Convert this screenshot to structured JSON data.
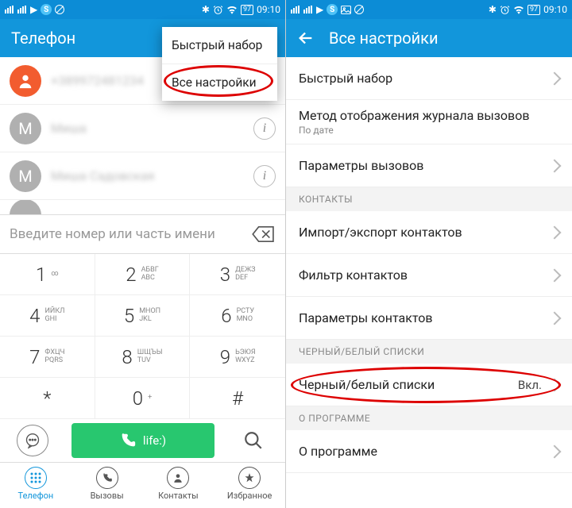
{
  "status": {
    "time": "09:10",
    "battery": "97"
  },
  "left": {
    "appTitle": "Телефон",
    "popup": {
      "item1": "Быстрый набор",
      "item2": "Все настройки"
    },
    "contacts": [
      {
        "letter": "",
        "name": "+389972481234"
      },
      {
        "letter": "M",
        "name": "Миша"
      },
      {
        "letter": "M",
        "name": "Миша Садовская"
      }
    ],
    "dialerPlaceholder": "Введите номер или часть имени",
    "keys": [
      {
        "n": "1",
        "l": "∞"
      },
      {
        "n": "2",
        "l": "АБВГ\nABC"
      },
      {
        "n": "3",
        "l": "ДЕЖЗ\nDEF"
      },
      {
        "n": "4",
        "l": "ИЙКЛ\nGHI"
      },
      {
        "n": "5",
        "l": "МНОП\nJKL"
      },
      {
        "n": "6",
        "l": "РСТУ\nMNO"
      },
      {
        "n": "7",
        "l": "ФХЦЧ\nPQRS"
      },
      {
        "n": "8",
        "l": "ШЩЪЫ\nTUV"
      },
      {
        "n": "9",
        "l": "ЬЭЮЯ\nWXYZ"
      },
      {
        "n": "*",
        "l": ""
      },
      {
        "n": "0",
        "l": "+"
      },
      {
        "n": "#",
        "l": ""
      }
    ],
    "callLabel": "life:)",
    "nav": {
      "phone": "Телефон",
      "calls": "Вызовы",
      "contacts": "Контакты",
      "fav": "Избранное"
    }
  },
  "right": {
    "appTitle": "Все настройки",
    "items": {
      "speedDial": "Быстрый набор",
      "callLog": "Метод отображения журнала вызовов",
      "callLogSub": "По дате",
      "callParams": "Параметры вызовов",
      "secContacts": "КОНТАКТЫ",
      "impExp": "Импорт/экспорт контактов",
      "filter": "Фильтр контактов",
      "contactParams": "Параметры контактов",
      "secLists": "ЧЕРНЫЙ/БЕЛЫЙ СПИСКИ",
      "bwList": "Черный/белый списки",
      "bwValue": "Вкл.",
      "secAbout": "О ПРОГРАММЕ",
      "about": "О программе"
    }
  }
}
